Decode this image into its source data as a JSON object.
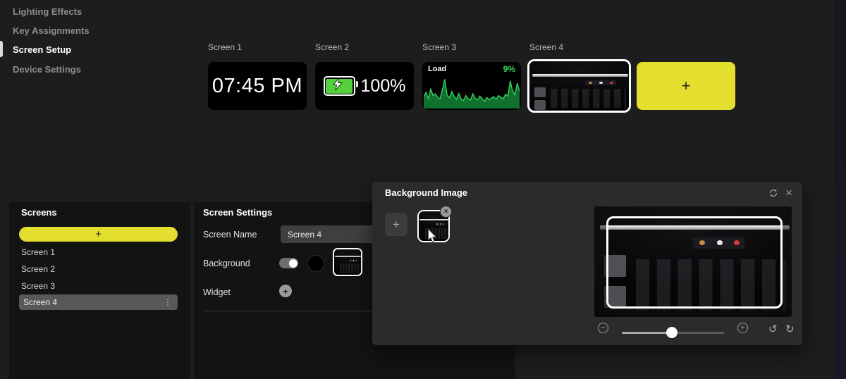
{
  "colors": {
    "accent": "#e4df2e",
    "chart_green": "#35d45e",
    "battery_green": "#55d13e"
  },
  "sidebar": {
    "items": [
      {
        "label": "Lighting Effects"
      },
      {
        "label": "Key Assignments"
      },
      {
        "label": "Screen Setup"
      },
      {
        "label": "Device Settings"
      }
    ],
    "active_item": "Screen Setup"
  },
  "preview_strip": {
    "screen1": {
      "label": "Screen 1",
      "clock_value": "07:45 PM"
    },
    "screen2": {
      "label": "Screen 2",
      "battery_value": "100%"
    },
    "screen3": {
      "label": "Screen 3"
    },
    "screen4": {
      "label": "Screen 4",
      "selected": true
    },
    "add_label": "+"
  },
  "chart_data": {
    "type": "area",
    "title": "Load",
    "value_label": "9%",
    "ylim": [
      0,
      100
    ],
    "points": [
      36,
      50,
      30,
      60,
      40,
      45,
      34,
      30,
      58,
      90,
      42,
      33,
      52,
      38,
      28,
      46,
      30,
      24,
      40,
      30,
      26,
      45,
      32,
      26,
      38,
      30,
      22,
      34,
      27,
      32,
      36,
      28,
      40,
      34,
      30,
      44,
      38,
      85,
      55,
      42,
      78,
      52
    ]
  },
  "screens_panel": {
    "title": "Screens",
    "add_label": "+",
    "items": [
      "Screen 1",
      "Screen 2",
      "Screen 3",
      "Screen 4"
    ],
    "selected_item": "Screen 4",
    "menu_icon": "⋮"
  },
  "settings_panel": {
    "title": "Screen Settings",
    "screen_name_label": "Screen Name",
    "screen_name_value": "Screen 4",
    "background_label": "Background",
    "background_enabled": true,
    "widget_label": "Widget"
  },
  "modal": {
    "title": "Background Image",
    "add_label": "+",
    "remove_label": "×",
    "close_label": "×",
    "zoom_out_label": "−",
    "zoom_in_label": "+",
    "rotate_ccw_label": "↺",
    "rotate_cw_label": "↻",
    "zoom_slider_pct": 49
  }
}
